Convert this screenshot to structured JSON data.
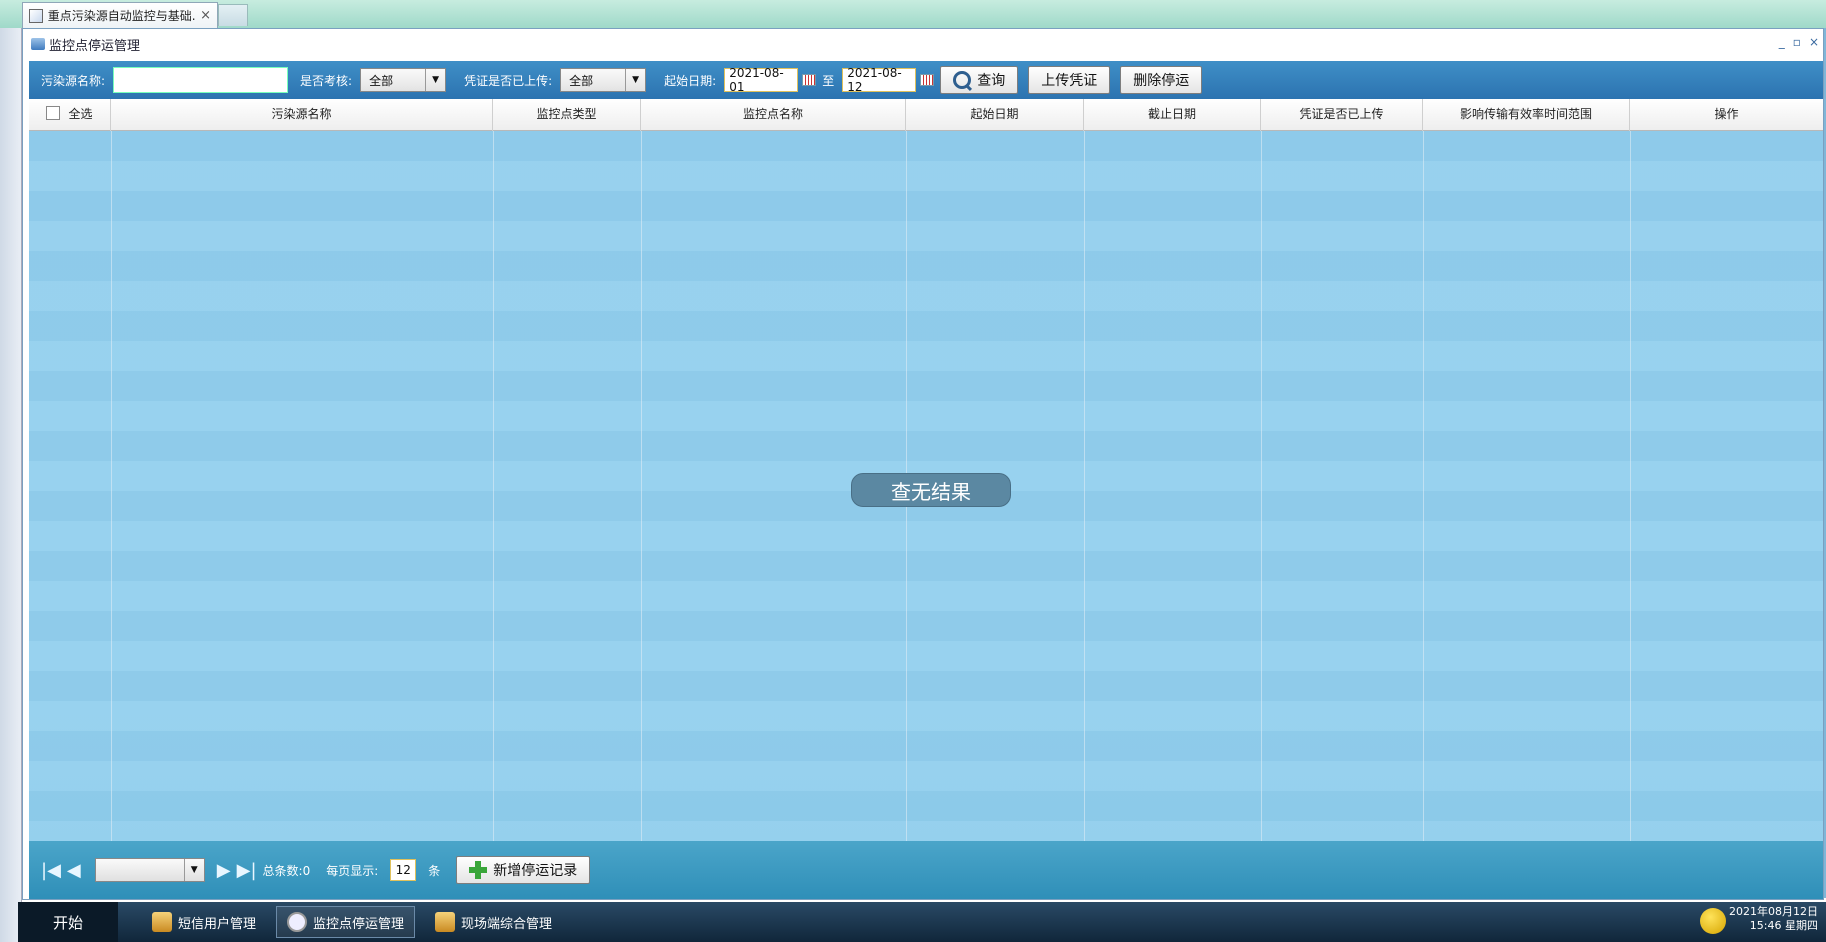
{
  "browser": {
    "tab_title": "重点污染源自动监控与基础...",
    "tab_close": "×"
  },
  "window": {
    "title": "监控点停运管理",
    "controls": [
      "_",
      "▫",
      "×"
    ]
  },
  "toolbar": {
    "source_name_label": "污染源名称:",
    "source_name_value": "",
    "assess_label": "是否考核:",
    "assess_value": "全部",
    "voucher_label": "凭证是否已上传:",
    "voucher_value": "全部",
    "start_date_label": "起始日期:",
    "start_date": "2021-08-01",
    "to_label": "至",
    "end_date": "2021-08-12",
    "query_button": "查询",
    "upload_button": "上传凭证",
    "delete_button": "删除停运"
  },
  "grid": {
    "select_all": "全选",
    "columns": [
      "污染源名称",
      "监控点类型",
      "监控点名称",
      "起始日期",
      "截止日期",
      "凭证是否已上传",
      "影响传输有效率时间范围",
      "操作"
    ],
    "empty_message": "查无结果"
  },
  "pager": {
    "page_select_value": "",
    "total_label": "总条数:0",
    "per_page_label": "每页显示:",
    "per_page_value": "12",
    "unit": "条",
    "add_button": "新增停运记录"
  },
  "taskbar": {
    "start": "开始",
    "tasks": [
      "短信用户管理",
      "监控点停运管理",
      "现场端综合管理"
    ],
    "date": "2021年08月12日",
    "time": "15:46 星期四"
  }
}
